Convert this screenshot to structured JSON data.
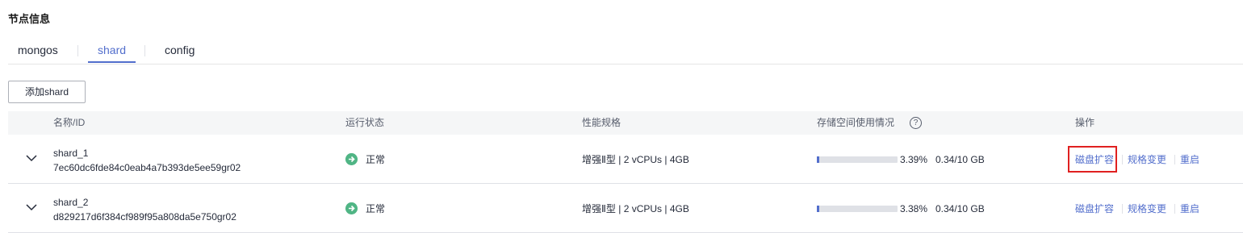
{
  "section": {
    "title": "节点信息"
  },
  "tabs": [
    {
      "label": "mongos",
      "active": false
    },
    {
      "label": "shard",
      "active": true
    },
    {
      "label": "config",
      "active": false
    }
  ],
  "toolbar": {
    "add_label": "添加shard"
  },
  "table": {
    "columns": [
      "名称/ID",
      "运行状态",
      "性能规格",
      "存储空间使用情况",
      "操作"
    ],
    "storage_help_icon": "question-circle-icon",
    "rows": [
      {
        "name": "shard_1",
        "id": "7ec60dc6fde84c0eab4a7b393de5ee59gr02",
        "status": "正常",
        "status_icon": "arrow-right-circle-icon",
        "spec": "增强Ⅱ型 | 2 vCPUs | 4GB",
        "usage_fraction": 0.0339,
        "usage_pct": "3.39%",
        "usage_amount": "0.34/10 GB",
        "actions": [
          "磁盘扩容",
          "规格变更",
          "重启"
        ],
        "highlighted_action": "磁盘扩容"
      },
      {
        "name": "shard_2",
        "id": "d829217d6f384cf989f95a808da5e750gr02",
        "status": "正常",
        "status_icon": "arrow-right-circle-icon",
        "spec": "增强Ⅱ型 | 2 vCPUs | 4GB",
        "usage_fraction": 0.0338,
        "usage_pct": "3.38%",
        "usage_amount": "0.34/10 GB",
        "actions": [
          "磁盘扩容",
          "规格变更",
          "重启"
        ]
      }
    ]
  },
  "colors": {
    "accent": "#526ecc",
    "status_ok": "#50b585",
    "highlight": "#e02020"
  }
}
